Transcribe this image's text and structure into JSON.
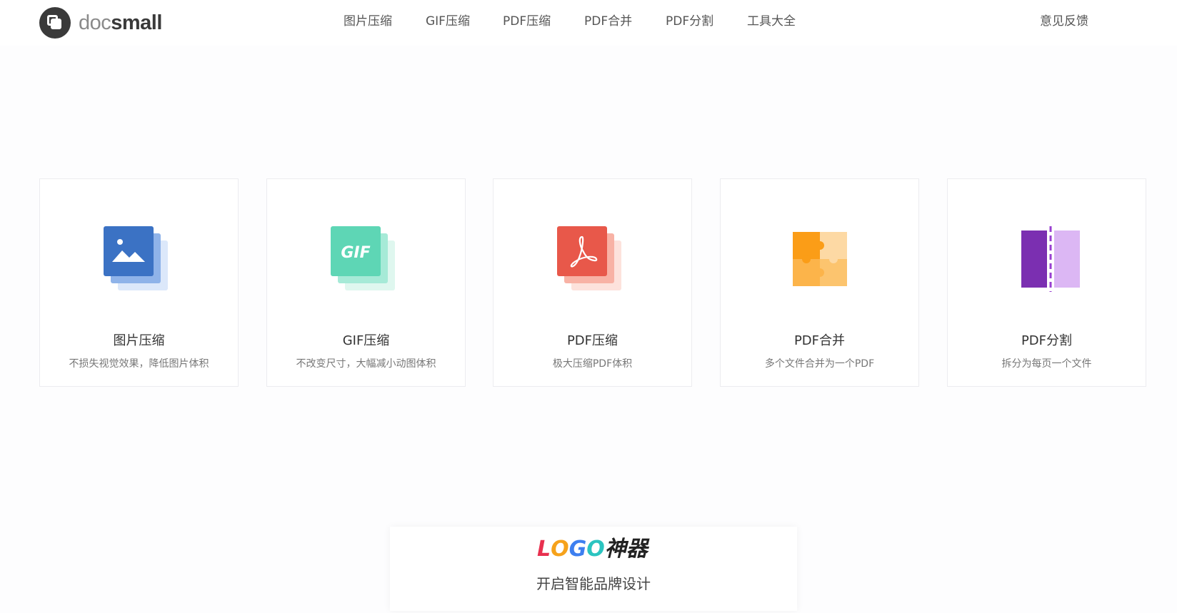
{
  "brand": {
    "prefix": "doc",
    "suffix": "small"
  },
  "nav": {
    "items": [
      "图片压缩",
      "GIF压缩",
      "PDF压缩",
      "PDF合并",
      "PDF分割",
      "工具大全"
    ],
    "feedback": "意见反馈"
  },
  "tools": [
    {
      "title": "图片压缩",
      "desc": "不损失视觉效果，降低图片体积",
      "icon": "image-icon"
    },
    {
      "title": "GIF压缩",
      "desc": "不改变尺寸，大幅减小动图体积",
      "icon": "gif-icon"
    },
    {
      "title": "PDF压缩",
      "desc": "极大压缩PDF体积",
      "icon": "pdf-icon"
    },
    {
      "title": "PDF合并",
      "desc": "多个文件合并为一个PDF",
      "icon": "puzzle-icon"
    },
    {
      "title": "PDF分割",
      "desc": "拆分为每页一个文件",
      "icon": "split-icon"
    }
  ],
  "banner": {
    "logo_text": [
      "L",
      "O",
      "G",
      "O",
      "神器"
    ],
    "subtitle": "开启智能品牌设计"
  },
  "colors": {
    "image_icon": "#3b72c4",
    "gif_icon": "#5ed6b5",
    "pdf_icon": "#e8584a",
    "puzzle_icon": "#fb9d17",
    "split_icon": "#7b2fb1"
  }
}
